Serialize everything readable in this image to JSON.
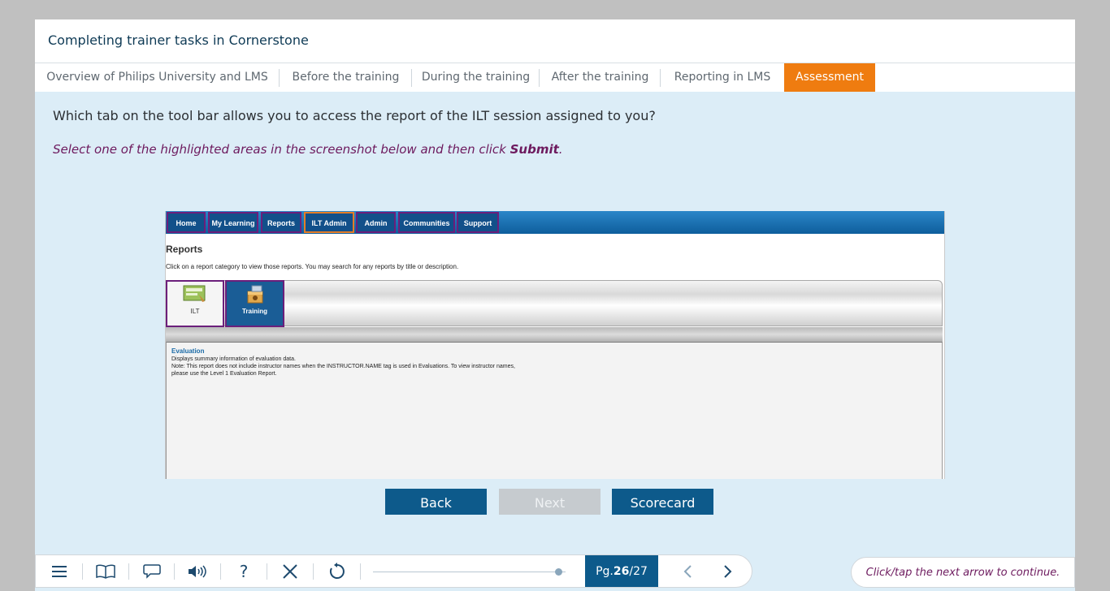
{
  "course_title": "Completing trainer tasks in Cornerstone",
  "tabs": [
    {
      "label": "Overview of Philips University and LMS",
      "active": false
    },
    {
      "label": "Before the training",
      "active": false
    },
    {
      "label": "During the training",
      "active": false
    },
    {
      "label": "After the training",
      "active": false
    },
    {
      "label": "Reporting in LMS",
      "active": false
    },
    {
      "label": "Assessment",
      "active": true
    }
  ],
  "question": "Which tab on the tool bar allows you to access the report of the ILT session assigned to you?",
  "instruction": {
    "text": "Select one of the highlighted areas in the screenshot below and then click ",
    "bold": "Submit",
    "end": "."
  },
  "screenshot": {
    "nav": [
      "Home",
      "My Learning",
      "Reports",
      "ILT Admin",
      "Admin",
      "Communities",
      "Support"
    ],
    "heading": "Reports",
    "description": "Click on a report category to view those reports. You may search for any reports by title or description.",
    "categories": [
      "ILT",
      "Training"
    ],
    "evaluation": {
      "title": "Evaluation",
      "lines": [
        "Displays summary information of evaluation data.",
        "Note: This report does not include instructor names when the INSTRUCTOR.NAME tag is used in Evaluations. To view instructor names,",
        "please use the Level 1 Evaluation Report."
      ]
    }
  },
  "buttons": {
    "back": "Back",
    "next": "Next",
    "scorecard": "Scorecard"
  },
  "toolbar": {
    "icons": [
      "menu-icon",
      "book-icon",
      "chat-icon",
      "speaker-icon",
      "help-icon",
      "close-icon",
      "replay-icon"
    ],
    "help_glyph": "?",
    "progress": 0.96,
    "page_prefix": "Pg. ",
    "page_current": "26",
    "page_total": "/27"
  },
  "hint": "Click/tap the next arrow to continue.",
  "colors": {
    "accent": "#ef7c10",
    "primary": "#0d5a8b",
    "instruction": "#6d1a5e",
    "highlight": "#6b1f7b"
  }
}
